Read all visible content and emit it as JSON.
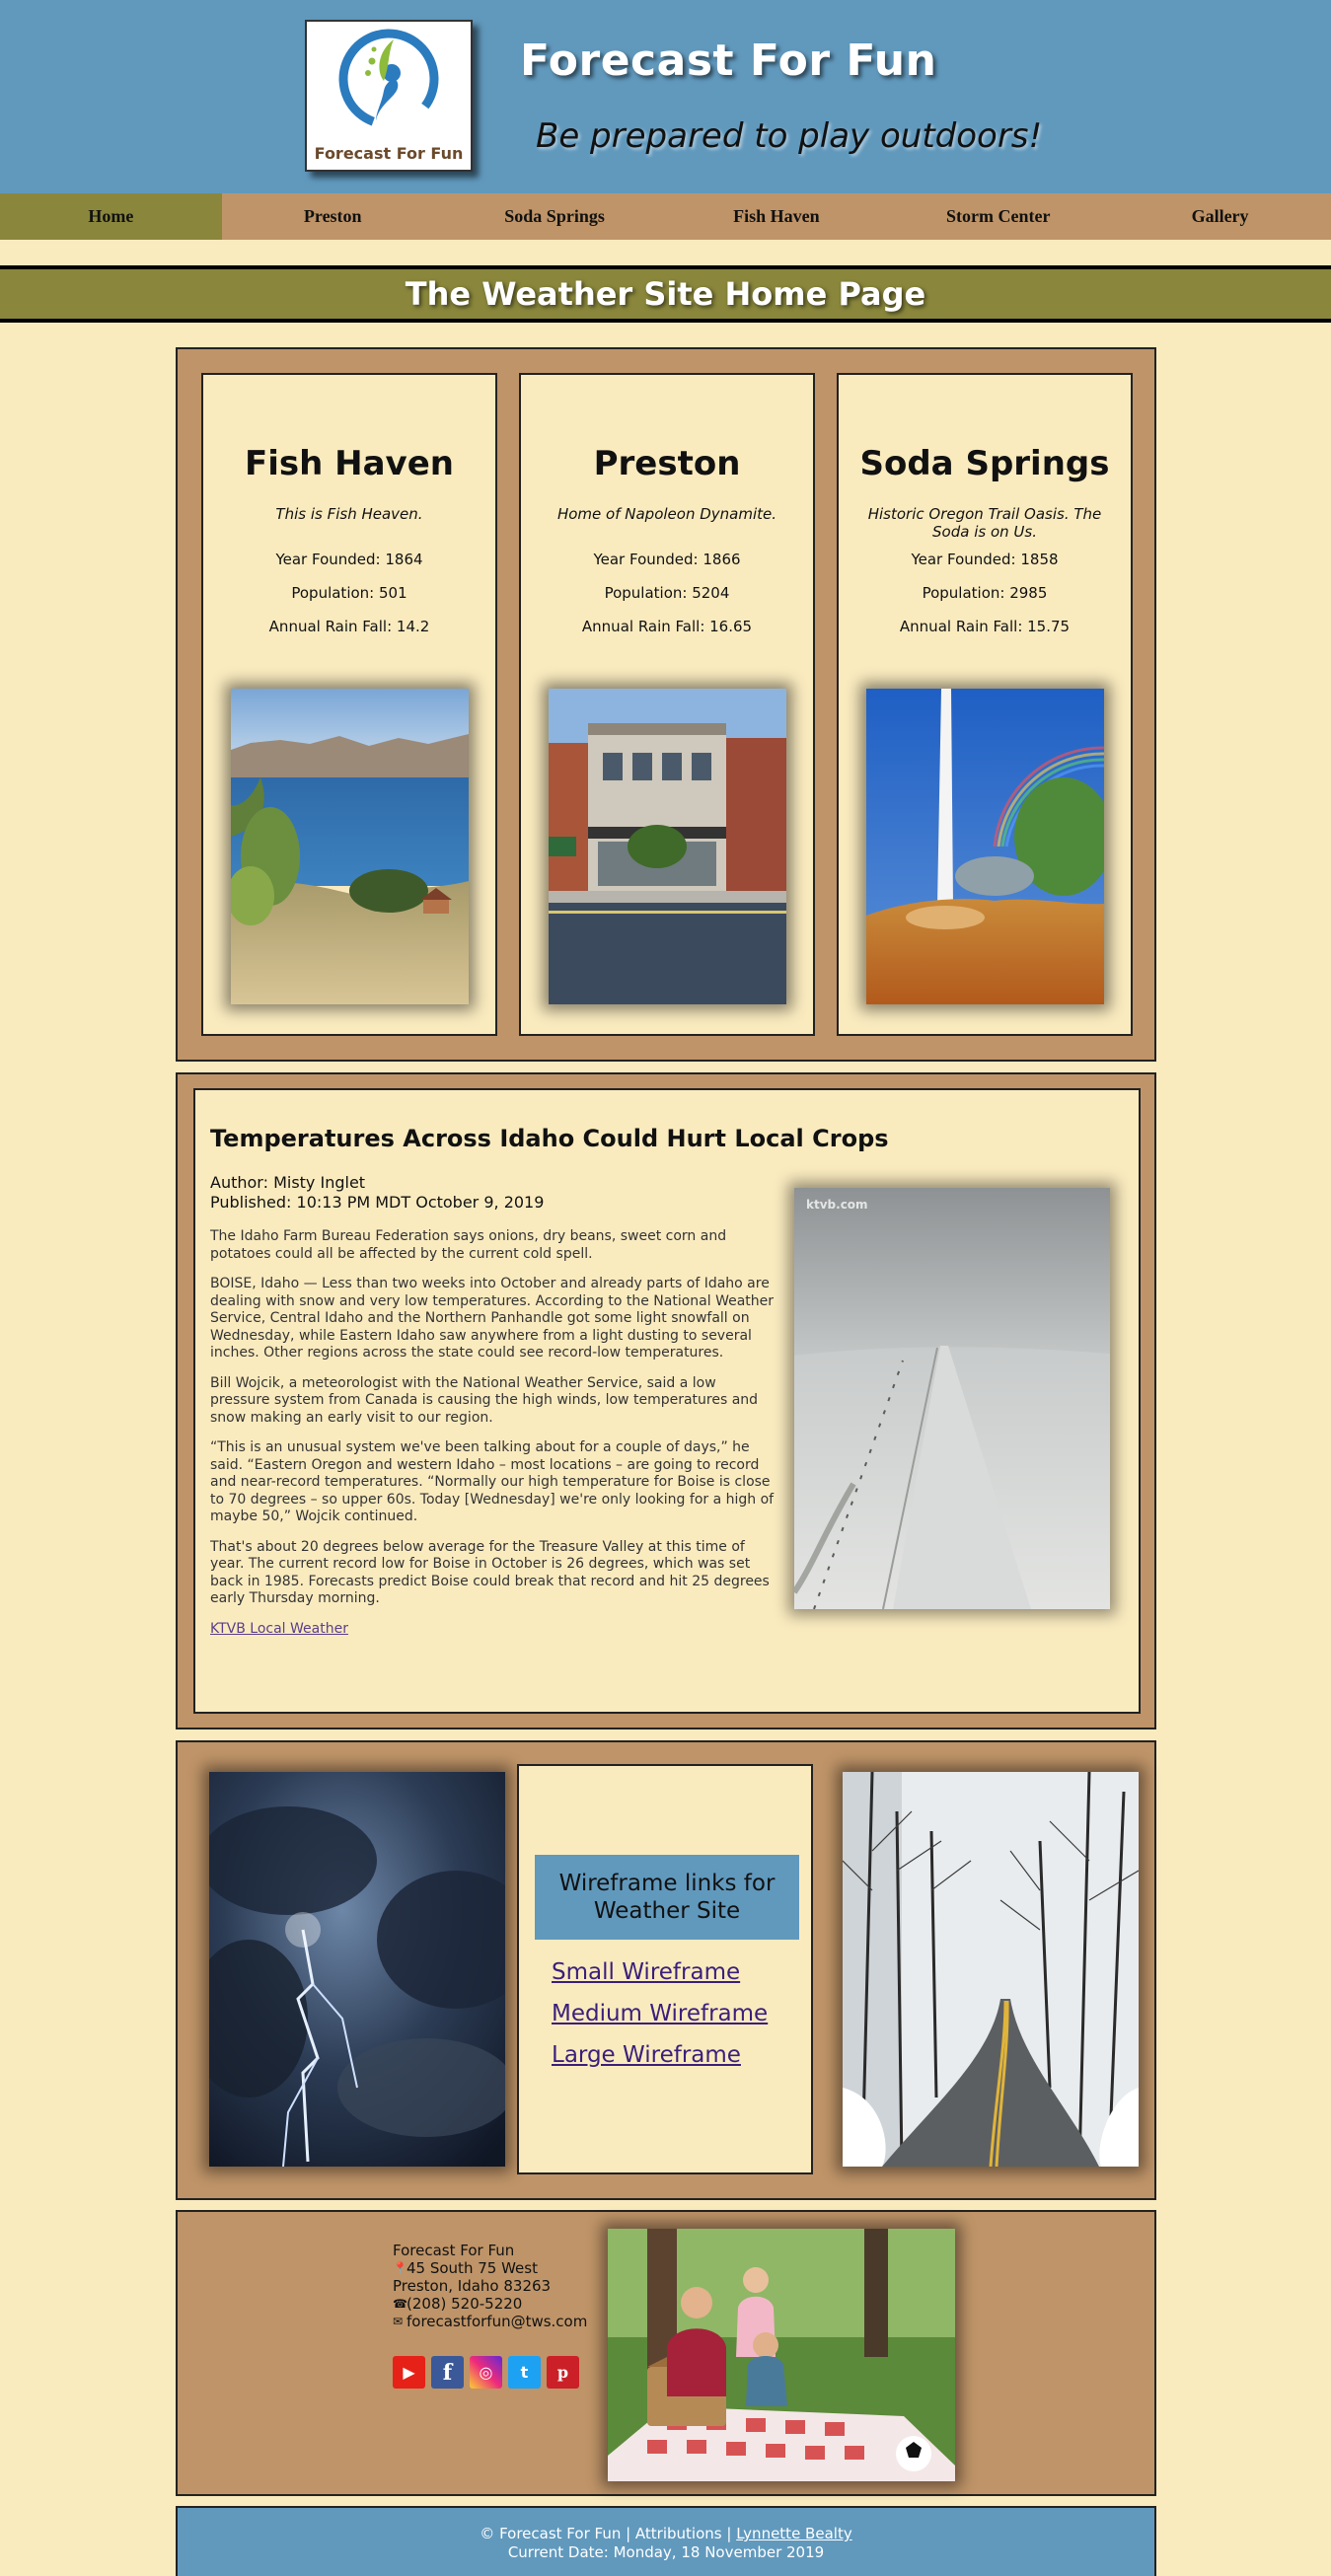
{
  "header": {
    "logo_text": "Forecast For Fun",
    "title": "Forecast For Fun",
    "tagline": "Be prepared to play outdoors!"
  },
  "nav": {
    "items": [
      {
        "label": "Home",
        "active": true
      },
      {
        "label": "Preston"
      },
      {
        "label": "Soda Springs"
      },
      {
        "label": "Fish Haven"
      },
      {
        "label": "Storm Center"
      },
      {
        "label": "Gallery"
      }
    ]
  },
  "page_title": "The Weather Site Home Page",
  "towns": [
    {
      "name": "Fish Haven",
      "motto": "This is Fish Heaven.",
      "founded": "Year Founded: 1864",
      "population": "Population: 501",
      "rain": "Annual Rain Fall: 14.2"
    },
    {
      "name": "Preston",
      "motto": "Home of Napoleon Dynamite.",
      "founded": "Year Founded: 1866",
      "population": "Population: 5204",
      "rain": "Annual Rain Fall: 16.65"
    },
    {
      "name": "Soda Springs",
      "motto": "Historic Oregon Trail Oasis. The Soda is on Us.",
      "founded": "Year Founded: 1858",
      "population": "Population: 2985",
      "rain": "Annual Rain Fall: 15.75"
    }
  ],
  "article": {
    "title": "Temperatures Across Idaho Could Hurt Local Crops",
    "author": "Author: Misty Inglet",
    "published": "Published: 10:13 PM MDT October 9, 2019",
    "paragraphs": [
      "The Idaho Farm Bureau Federation says onions, dry beans, sweet corn and potatoes could all be affected by the current cold spell.",
      "BOISE, Idaho — Less than two weeks into October and already parts of Idaho are dealing with snow and very low temperatures. According to the National Weather Service, Central Idaho and the Northern Panhandle got some light snowfall on Wednesday, while Eastern Idaho saw anywhere from a light dusting to several inches. Other regions across the state could see record-low temperatures.",
      "Bill Wojcik, a meteorologist with the National Weather Service, said a low pressure system from Canada is causing the high winds, low temperatures and snow making an early visit to our region.",
      "“This is an unusual system we've been talking about for a couple of days,” he said. “Eastern Oregon and western Idaho – most locations – are going to record and near-record temperatures. “Normally our high temperature for Boise is close to 70 degrees – so upper 60s. Today [Wednesday] we're only looking for a high of maybe 50,” Wojcik continued.",
      "That's about 20 degrees below average for the Treasure Valley at this time of year. The current record low for Boise in October is 26 degrees, which was set back in 1985. Forecasts predict Boise could break that record and hit 25 degrees early Thursday morning."
    ],
    "link_label": "KTVB Local Weather",
    "photo_watermark": "ktvb.com"
  },
  "wireframes": {
    "heading": "Wireframe links for Weather Site",
    "links": [
      "Small Wireframe",
      "Medium Wireframe",
      "Large Wireframe"
    ]
  },
  "contact": {
    "name": "Forecast For Fun",
    "street": "45 South 75 West",
    "city": "Preston, Idaho 83263",
    "phone": "(208) 520-5220",
    "email": "forecastforfun@tws.com"
  },
  "social_icons": [
    {
      "name": "youtube-icon",
      "glyph": "▶",
      "color": "#e62117"
    },
    {
      "name": "facebook-icon",
      "glyph": "f",
      "color": "#3b5998"
    },
    {
      "name": "instagram-icon",
      "glyph": "◎",
      "color": "#d6249f"
    },
    {
      "name": "twitter-icon",
      "glyph": "t",
      "color": "#1da1f2"
    },
    {
      "name": "pinterest-icon",
      "glyph": "p",
      "color": "#cb2027"
    }
  ],
  "footer": {
    "line1_prefix": "© Forecast For Fun | Attributions |",
    "author_link": "Lynnette Bealty",
    "line2": "Current Date: Monday, 18 November 2019"
  },
  "colors": {
    "header_blue": "#6199bd",
    "nav_tan": "#bf9468",
    "olive": "#8a873c",
    "cream": "#faebbf"
  }
}
